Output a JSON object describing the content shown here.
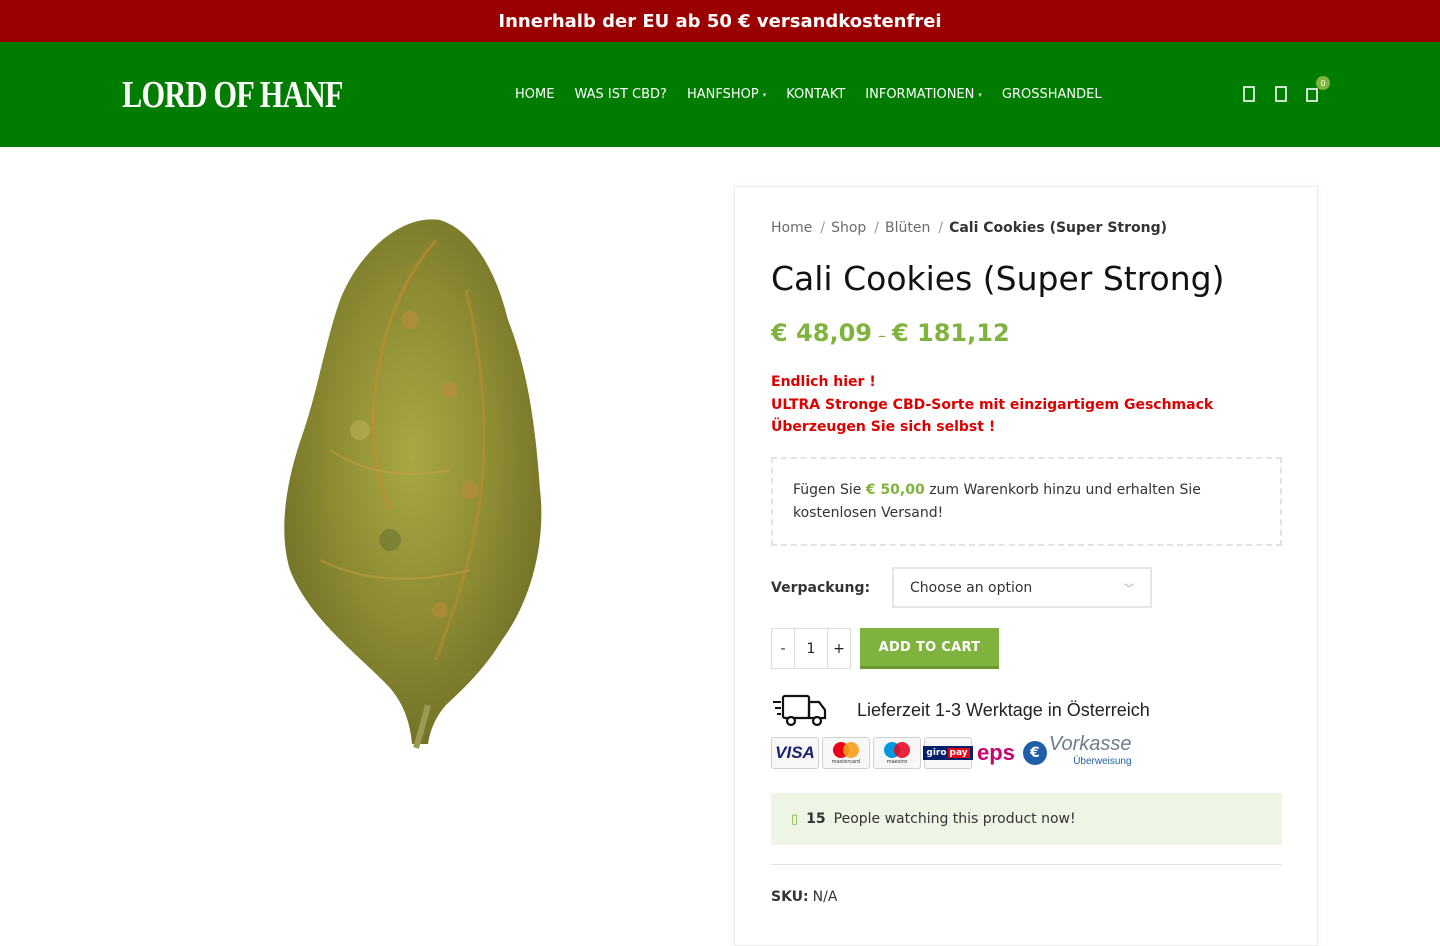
{
  "promo_bar": {
    "text": "Innerhalb der EU ab 50 € versandkostenfrei"
  },
  "header": {
    "logo_text": "LORD OF HANF",
    "nav": [
      {
        "label": "HOME",
        "has_dropdown": false
      },
      {
        "label": "WAS IST CBD?",
        "has_dropdown": false
      },
      {
        "label": "HANFSHOP",
        "has_dropdown": true
      },
      {
        "label": "KONTAKT",
        "has_dropdown": false
      },
      {
        "label": "INFORMATIONEN",
        "has_dropdown": true
      },
      {
        "label": "GROSSHANDEL",
        "has_dropdown": false
      }
    ],
    "icons": [
      "search-icon",
      "account-icon",
      "cart-icon"
    ],
    "cart_count": "0"
  },
  "breadcrumb": {
    "items": [
      "Home",
      "Shop",
      "Blüten"
    ],
    "separator": "/",
    "current": "Cali Cookies (Super Strong)"
  },
  "product": {
    "title": "Cali Cookies (Super Strong)",
    "price_from": "€ 48,09",
    "price_to": "€ 181,12",
    "price_dash": "–",
    "promo_lines": [
      "Endlich hier !",
      "ULTRA Stronge CBD-Sorte mit einzigartigem Geschmack",
      "Überzeugen Sie sich selbst !"
    ]
  },
  "shipping_notice": {
    "prefix": "Fügen Sie",
    "amount": "€ 50,00",
    "suffix": "zum Warenkorb hinzu und erhalten Sie kostenlosen Versand!"
  },
  "variation": {
    "label": "Verpackung",
    "placeholder": "Choose an option"
  },
  "quantity": {
    "minus": "-",
    "value": "1",
    "plus": "+"
  },
  "add_to_cart": {
    "label": "ADD TO CART"
  },
  "delivery": {
    "text": "Lieferzeit 1-3 Werktage in Österreich",
    "payment_methods": [
      "VISA",
      "mastercard",
      "maestro",
      "giropay",
      "eps",
      "Vorkasse"
    ],
    "payment_logo_text": {
      "visa": "VISA",
      "mastercard": "mastercard",
      "maestro": "maestro",
      "giro": "giro",
      "pay": "pay",
      "eps": "eps",
      "vorkasse": "Vorkasse",
      "vorkasse_sub": "Überweisung"
    }
  },
  "watching": {
    "count": "15",
    "text": "People watching this product now!"
  },
  "sku": {
    "label": "SKU:",
    "value": "N/A"
  },
  "colors": {
    "promo_bar": "#9b0000",
    "header": "#007d00",
    "accent_green": "#7fb33d",
    "promo_red": "#dd0000",
    "watching_bg": "#eef5e4"
  }
}
